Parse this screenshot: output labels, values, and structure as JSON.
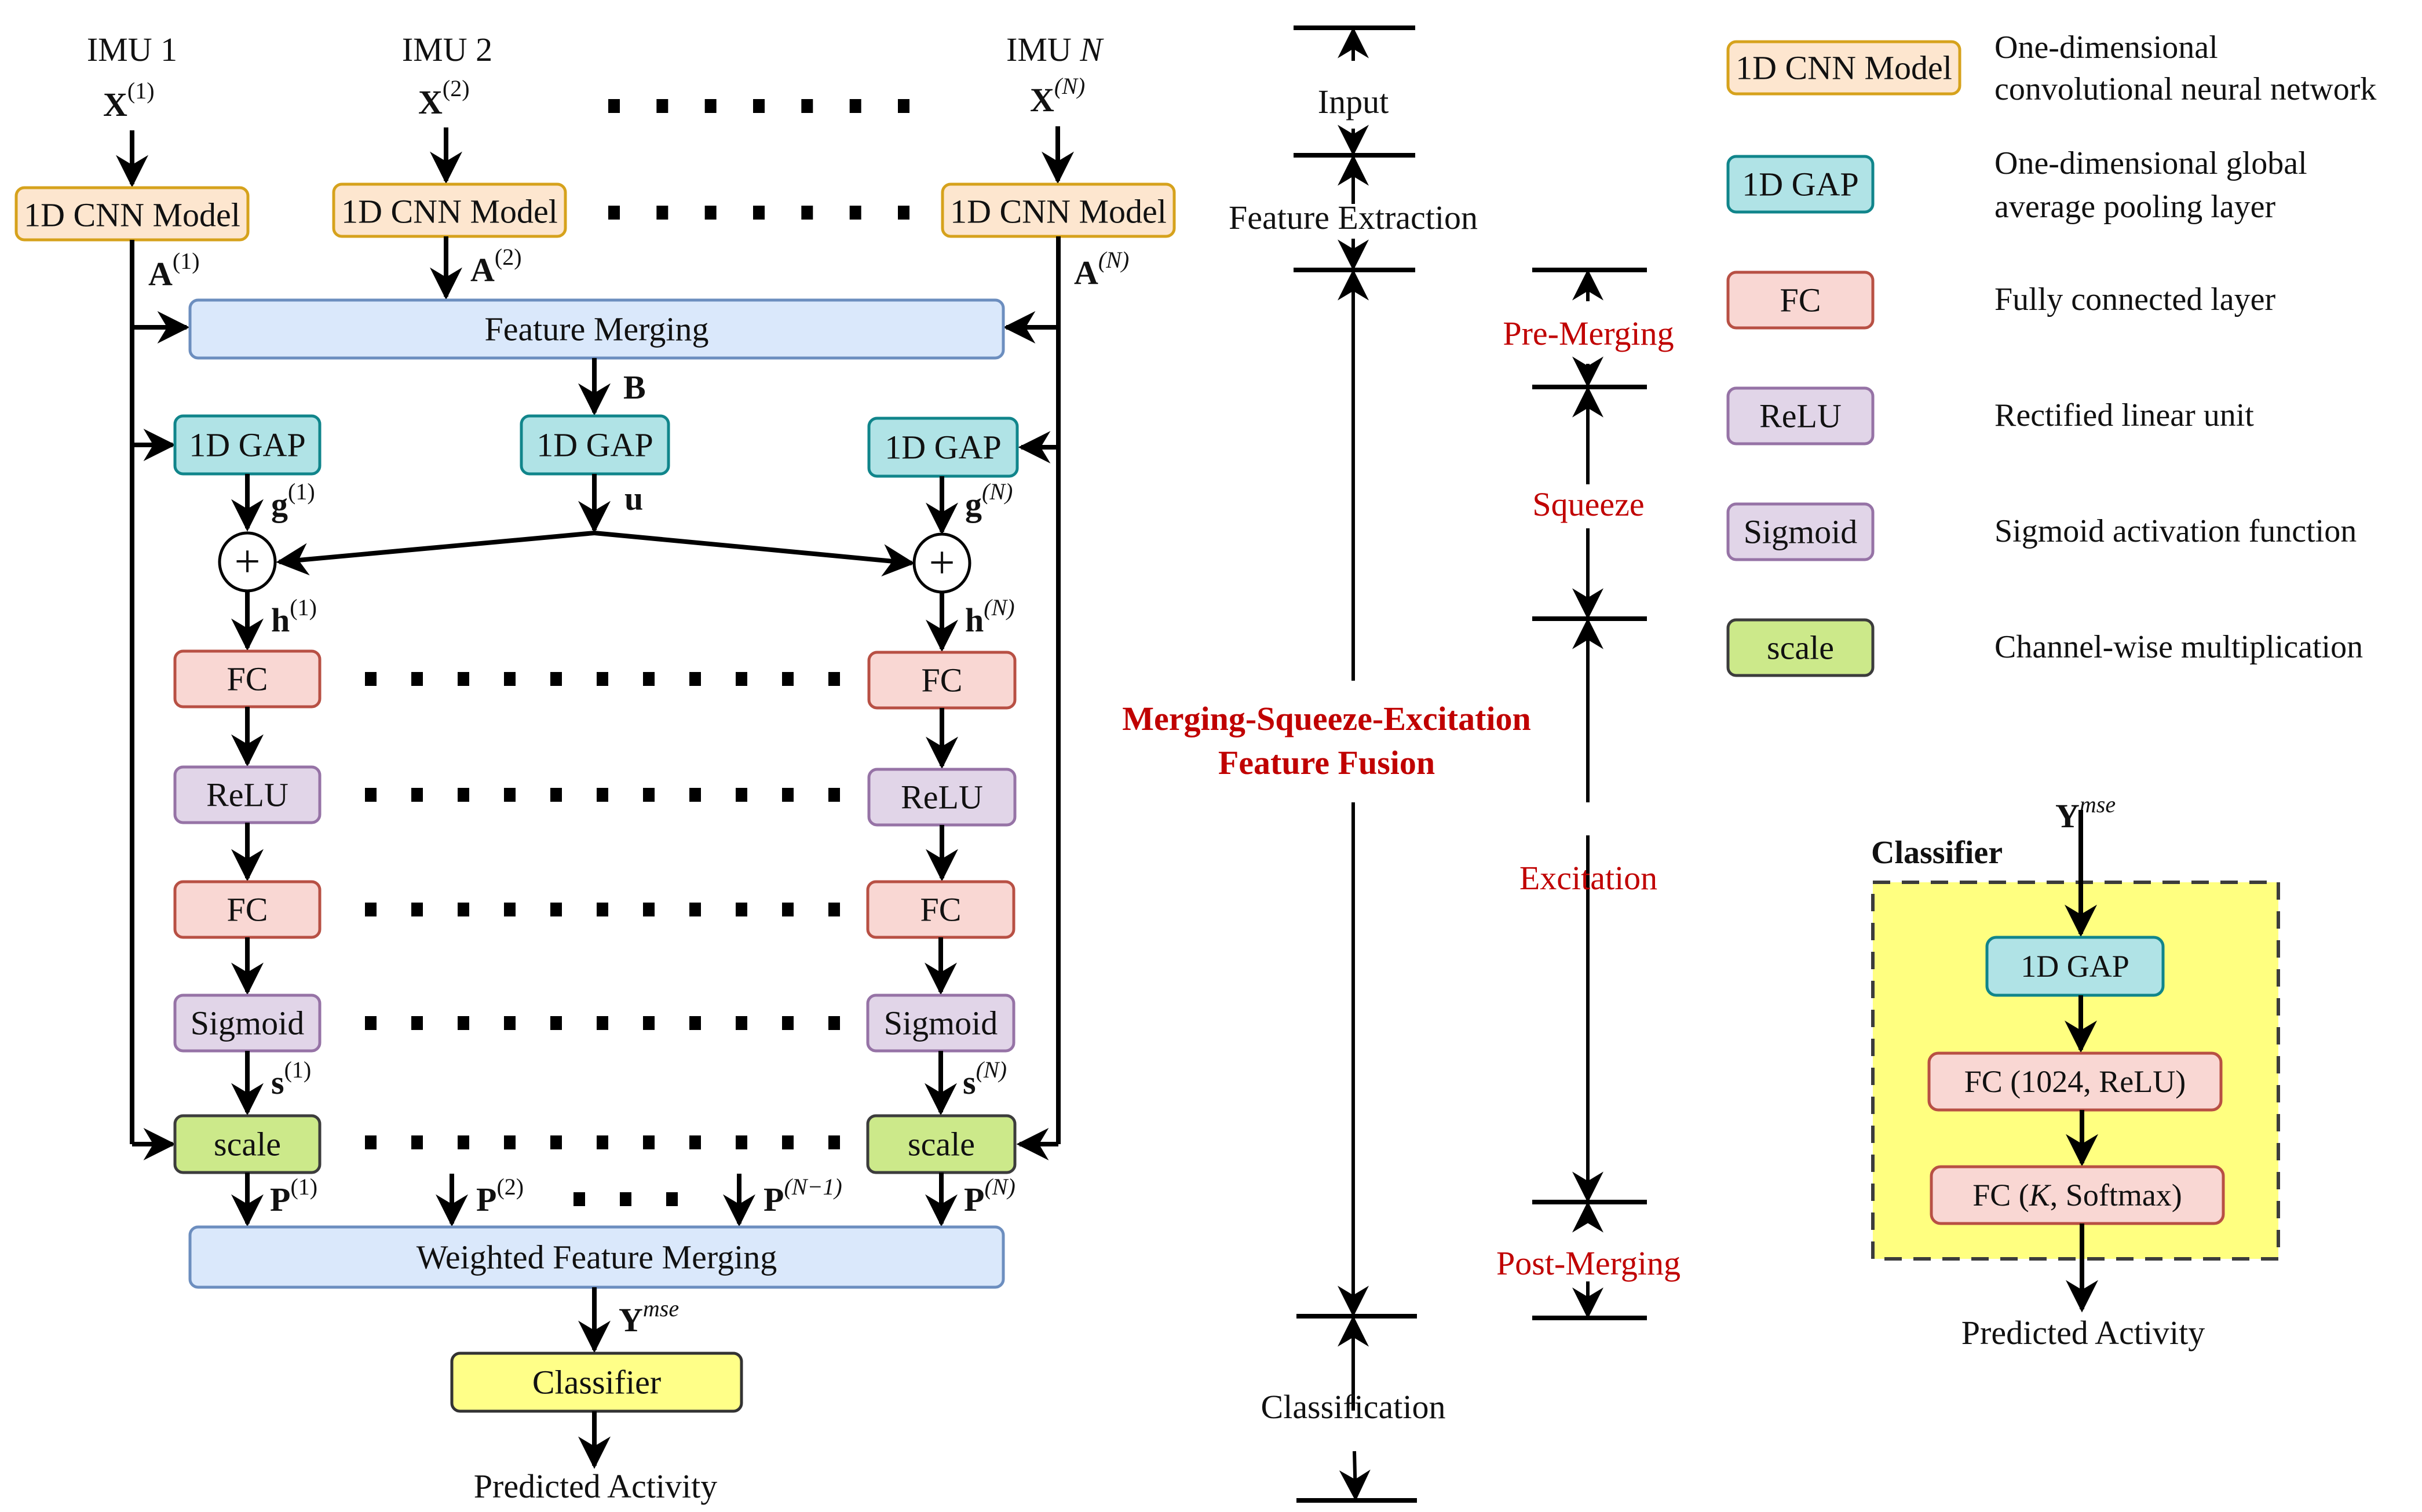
{
  "figure": {
    "colors": {
      "cnn_fill": "#fde6cf",
      "cnn_border": "#d6a21c",
      "gap_fill": "#b0e3e6",
      "gap_border": "#10858b",
      "fc_fill": "#f9d7d3",
      "fc_border": "#b85044",
      "act_fill": "#e1d5e8",
      "act_border": "#9673a6",
      "scale_fill": "#cce98a",
      "scale_border": "#3c3c3c",
      "merge_fill": "#dae8fb",
      "merge_border": "#6c8ebf",
      "classifier_fill": "#ffff88",
      "stage_text": "#c00000"
    }
  },
  "inputs": [
    {
      "imu": "IMU 1",
      "x_var": "X",
      "x_sup": "(1)",
      "a_var": "A",
      "a_sup": "(1)"
    },
    {
      "imu": "IMU 2",
      "x_var": "X",
      "x_sup": "(2)",
      "a_var": "A",
      "a_sup": "(2)"
    },
    {
      "imu_prefix": "IMU ",
      "imu_n": "N",
      "x_var": "X",
      "x_sup": "(N)",
      "a_var": "A",
      "a_sup": "(N)"
    }
  ],
  "blocks": {
    "cnn": "1D CNN Model",
    "feature_merging": "Feature Merging",
    "gap": "1D GAP",
    "fc": "FC",
    "relu": "ReLU",
    "sigmoid": "Sigmoid",
    "scale": "scale",
    "weighted_merging": "Weighted Feature Merging",
    "classifier": "Classifier",
    "plus": "+"
  },
  "variables": {
    "B": "B",
    "u": "u",
    "g1": {
      "v": "g",
      "s": "(1)"
    },
    "gN": {
      "v": "g",
      "s": "(N)"
    },
    "h1": {
      "v": "h",
      "s": "(1)"
    },
    "hN": {
      "v": "h",
      "s": "(N)"
    },
    "s1": {
      "v": "s",
      "s": "(1)"
    },
    "sN": {
      "v": "s",
      "s": "(N)"
    },
    "P1": {
      "v": "P",
      "s": "(1)"
    },
    "P2": {
      "v": "P",
      "s": "(2)"
    },
    "PN1": {
      "v": "P",
      "s": "(N−1)"
    },
    "PN": {
      "v": "P",
      "s": "(N)"
    },
    "Y": {
      "v": "Y",
      "s": "mse"
    }
  },
  "output_label": "Predicted Activity",
  "stages": {
    "input": "Input",
    "feature_extraction": "Feature Extraction",
    "msef_line1": "Merging-Squeeze-Excitation",
    "msef_line2": "Feature Fusion",
    "classification": "Classification",
    "pre_merging": "Pre-Merging",
    "squeeze": "Squeeze",
    "excitation": "Excitation",
    "post_merging": "Post-Merging"
  },
  "legend": [
    {
      "key": "1D CNN Model",
      "kind": "cnn",
      "desc": [
        "One-dimensional",
        "convolutional neural network"
      ]
    },
    {
      "key": "1D GAP",
      "kind": "gap",
      "desc": [
        "One-dimensional global",
        "average pooling layer"
      ]
    },
    {
      "key": "FC",
      "kind": "fc",
      "desc": [
        "Fully connected layer"
      ]
    },
    {
      "key": "ReLU",
      "kind": "relu",
      "desc": [
        "Rectified linear unit"
      ]
    },
    {
      "key": "Sigmoid",
      "kind": "relu",
      "desc": [
        "Sigmoid activation function"
      ]
    },
    {
      "key": "scale",
      "kind": "scale",
      "desc": [
        "Channel-wise multiplication"
      ]
    }
  ],
  "classifier_detail": {
    "title": "Classifier",
    "input_var": "Y",
    "input_sup": "mse",
    "layers": [
      "1D GAP",
      "FC (1024, ReLU)"
    ],
    "last_layer_prefix": "FC (",
    "last_layer_k": "K",
    "last_layer_suffix": ", Softmax)",
    "output": "Predicted Activity"
  }
}
